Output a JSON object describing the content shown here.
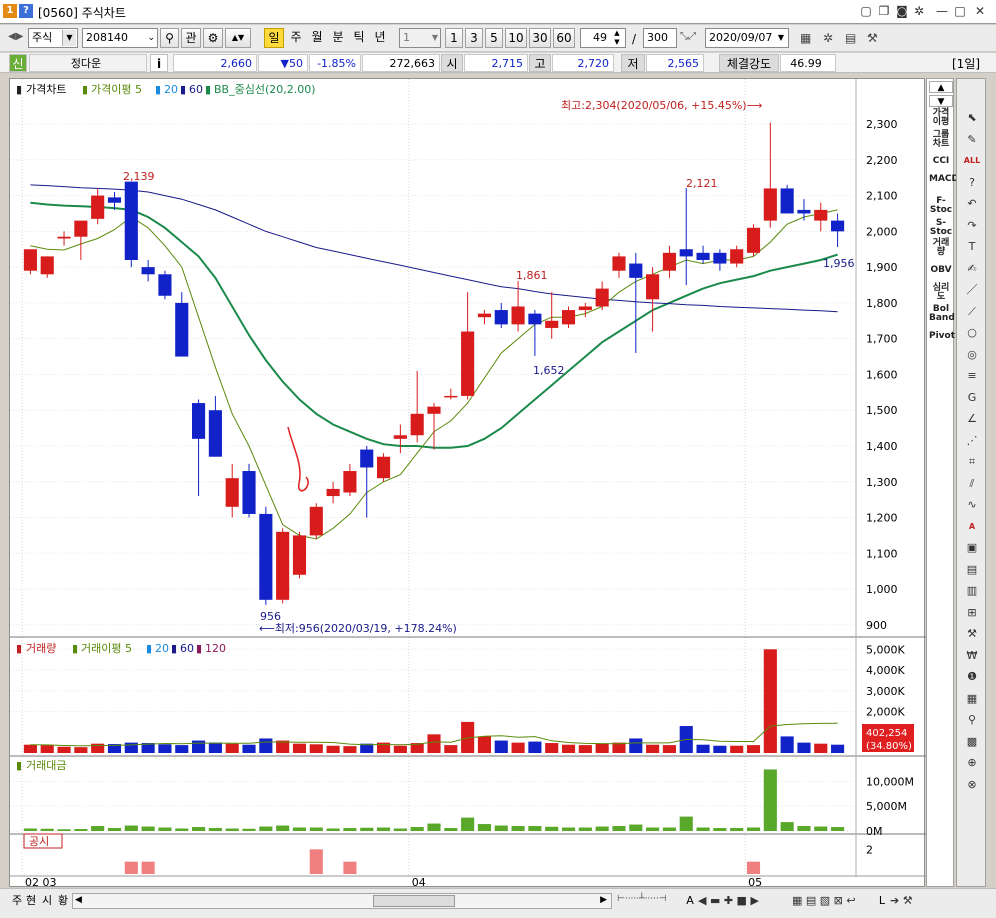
{
  "window": {
    "badge_num": "1",
    "badge_help": "?",
    "title": "[0560] 주식차트"
  },
  "toolbar": {
    "market": "주식",
    "code": "208140",
    "btn_watch": "관",
    "periods": [
      "일",
      "주",
      "월",
      "분",
      "틱",
      "년"
    ],
    "active_period": "일",
    "interval": "1",
    "quick_intervals": [
      "1",
      "3",
      "5",
      "10",
      "30",
      "60"
    ],
    "view_count": "49",
    "total_count": "300",
    "separator": "/",
    "date": "2020/09/07"
  },
  "quote": {
    "type_badge": "신",
    "name": "정다운",
    "info_btn": "i",
    "price": "2,660",
    "change": "▼50",
    "change_pct": "-1.85%",
    "volume": "272,663",
    "open_label": "시",
    "open": "2,715",
    "high_label": "고",
    "high": "2,720",
    "low_label": "저",
    "low": "2,565",
    "strength_label": "체결강도",
    "strength": "46.99",
    "period_tag": "[1일]"
  },
  "chart_data": {
    "type": "candlestick",
    "price_panel": {
      "legend": [
        "가격차트",
        "가격이평 5",
        "20",
        "60",
        "BB_중심선(20,2.00)"
      ],
      "y_ticks": [
        2300,
        2200,
        2100,
        2000,
        1900,
        1800,
        1700,
        1600,
        1500,
        1400,
        1300,
        1200,
        1100,
        1000,
        900
      ],
      "y_tick_labels": [
        "2,300",
        "2,200",
        "2,100",
        "2,000",
        "1,900",
        "1,800",
        "1,700",
        "1,600",
        "1,500",
        "1,400",
        "1,300",
        "1,200",
        "1,100",
        "1,000",
        "900"
      ],
      "ylim": [
        880,
        2370
      ],
      "candles": [
        {
          "o": 1890,
          "h": 1940,
          "l": 1880,
          "c": 1950
        },
        {
          "o": 1880,
          "h": 1930,
          "l": 1870,
          "c": 1930
        },
        {
          "o": 1980,
          "h": 2000,
          "l": 1960,
          "c": 1985
        },
        {
          "o": 1985,
          "h": 2010,
          "l": 1920,
          "c": 2030
        },
        {
          "o": 2035,
          "h": 2120,
          "l": 2020,
          "c": 2100
        },
        {
          "o": 2095,
          "h": 2110,
          "l": 2060,
          "c": 2080
        },
        {
          "o": 2139,
          "h": 2139,
          "l": 1900,
          "c": 1920
        },
        {
          "o": 1900,
          "h": 1920,
          "l": 1860,
          "c": 1880
        },
        {
          "o": 1880,
          "h": 1890,
          "l": 1810,
          "c": 1820
        },
        {
          "o": 1800,
          "h": 1830,
          "l": 1650,
          "c": 1650
        },
        {
          "o": 1520,
          "h": 1530,
          "l": 1260,
          "c": 1420
        },
        {
          "o": 1500,
          "h": 1540,
          "l": 1370,
          "c": 1370
        },
        {
          "o": 1230,
          "h": 1350,
          "l": 1200,
          "c": 1310
        },
        {
          "o": 1330,
          "h": 1350,
          "l": 1200,
          "c": 1210
        },
        {
          "o": 1210,
          "h": 1230,
          "l": 956,
          "c": 970
        },
        {
          "o": 970,
          "h": 1170,
          "l": 960,
          "c": 1160
        },
        {
          "o": 1040,
          "h": 1160,
          "l": 1030,
          "c": 1150
        },
        {
          "o": 1150,
          "h": 1240,
          "l": 1140,
          "c": 1230
        },
        {
          "o": 1260,
          "h": 1300,
          "l": 1240,
          "c": 1280
        },
        {
          "o": 1270,
          "h": 1350,
          "l": 1260,
          "c": 1330
        },
        {
          "o": 1390,
          "h": 1400,
          "l": 1200,
          "c": 1340
        },
        {
          "o": 1310,
          "h": 1380,
          "l": 1300,
          "c": 1370
        },
        {
          "o": 1420,
          "h": 1460,
          "l": 1380,
          "c": 1430
        },
        {
          "o": 1430,
          "h": 1610,
          "l": 1410,
          "c": 1490
        },
        {
          "o": 1490,
          "h": 1520,
          "l": 1390,
          "c": 1510
        },
        {
          "o": 1540,
          "h": 1560,
          "l": 1530,
          "c": 1540
        },
        {
          "o": 1540,
          "h": 1830,
          "l": 1530,
          "c": 1720
        },
        {
          "o": 1760,
          "h": 1780,
          "l": 1740,
          "c": 1770
        },
        {
          "o": 1780,
          "h": 1800,
          "l": 1730,
          "c": 1740
        },
        {
          "o": 1740,
          "h": 1861,
          "l": 1720,
          "c": 1790
        },
        {
          "o": 1770,
          "h": 1780,
          "l": 1652,
          "c": 1740
        },
        {
          "o": 1730,
          "h": 1830,
          "l": 1700,
          "c": 1750
        },
        {
          "o": 1740,
          "h": 1790,
          "l": 1730,
          "c": 1780
        },
        {
          "o": 1780,
          "h": 1800,
          "l": 1760,
          "c": 1790
        },
        {
          "o": 1790,
          "h": 1860,
          "l": 1780,
          "c": 1840
        },
        {
          "o": 1890,
          "h": 1940,
          "l": 1870,
          "c": 1930
        },
        {
          "o": 1910,
          "h": 1940,
          "l": 1660,
          "c": 1870
        },
        {
          "o": 1810,
          "h": 1900,
          "l": 1720,
          "c": 1880
        },
        {
          "o": 1890,
          "h": 1960,
          "l": 1870,
          "c": 1940
        },
        {
          "o": 1950,
          "h": 2121,
          "l": 1850,
          "c": 1930
        },
        {
          "o": 1940,
          "h": 1960,
          "l": 1910,
          "c": 1920
        },
        {
          "o": 1940,
          "h": 1950,
          "l": 1890,
          "c": 1910
        },
        {
          "o": 1910,
          "h": 1960,
          "l": 1900,
          "c": 1950
        },
        {
          "o": 1940,
          "h": 2020,
          "l": 1930,
          "c": 2010
        },
        {
          "o": 2030,
          "h": 2304,
          "l": 2010,
          "c": 2120
        },
        {
          "o": 2120,
          "h": 2130,
          "l": 2050,
          "c": 2050
        },
        {
          "o": 2060,
          "h": 2090,
          "l": 2030,
          "c": 2050
        },
        {
          "o": 2030,
          "h": 2080,
          "l": 2000,
          "c": 2060
        },
        {
          "o": 2030,
          "h": 2050,
          "l": 1956,
          "c": 2000
        }
      ],
      "ma5": [
        1960,
        1950,
        1948,
        1965,
        1980,
        2005,
        2040,
        2010,
        1960,
        1900,
        1760,
        1620,
        1490,
        1400,
        1290,
        1180,
        1150,
        1140,
        1170,
        1210,
        1270,
        1300,
        1320,
        1380,
        1440,
        1470,
        1520,
        1590,
        1660,
        1700,
        1740,
        1760,
        1760,
        1770,
        1790,
        1830,
        1860,
        1880,
        1900,
        1920,
        1910,
        1920,
        1920,
        1930,
        1970,
        2020,
        2040,
        2050,
        2060
      ],
      "ma60": [
        2130,
        2128,
        2125,
        2122,
        2120,
        2118,
        2115,
        2110,
        2100,
        2090,
        2075,
        2060,
        2040,
        2020,
        2000,
        1985,
        1970,
        1955,
        1945,
        1935,
        1925,
        1915,
        1905,
        1895,
        1885,
        1875,
        1865,
        1855,
        1845,
        1840,
        1832,
        1825,
        1820,
        1815,
        1810,
        1807,
        1803,
        1800,
        1798,
        1795,
        1793,
        1790,
        1788,
        1786,
        1784,
        1782,
        1780,
        1778,
        1775
      ],
      "bb_mid": [
        2080,
        2075,
        2072,
        2070,
        2068,
        2065,
        2060,
        2040,
        2010,
        1970,
        1930,
        1870,
        1790,
        1710,
        1640,
        1580,
        1530,
        1490,
        1460,
        1440,
        1420,
        1405,
        1400,
        1400,
        1395,
        1395,
        1400,
        1420,
        1450,
        1490,
        1530,
        1570,
        1610,
        1650,
        1690,
        1720,
        1750,
        1780,
        1800,
        1820,
        1840,
        1855,
        1865,
        1875,
        1890,
        1900,
        1910,
        1920,
        1935
      ],
      "annotations": {
        "max_label": "최고:2,304(2020/05/06, +15.45%)⟶",
        "min_label": "⟵최저:956(2020/03/19, +178.24%)",
        "peak1": "2,139",
        "peak2": "2,121",
        "peak3": "1,861",
        "trough1": "956",
        "trough2": "1,652",
        "last": "1,956"
      }
    },
    "volume_panel": {
      "legend": [
        "거래량",
        "거래이평 5",
        "20",
        "60",
        "120"
      ],
      "y_tick_labels": [
        "5,000K",
        "4,000K",
        "3,000K",
        "2,000K"
      ],
      "y_ticks": [
        5000,
        4000,
        3000,
        2000
      ],
      "ylim": [
        0,
        5400
      ],
      "values": [
        400,
        380,
        300,
        280,
        450,
        430,
        500,
        480,
        420,
        380,
        600,
        500,
        450,
        400,
        700,
        600,
        450,
        420,
        350,
        330,
        450,
        500,
        350,
        480,
        900,
        380,
        1500,
        800,
        600,
        500,
        550,
        480,
        400,
        380,
        450,
        500,
        700,
        400,
        380,
        1300,
        400,
        350,
        350,
        380,
        5000,
        800,
        500,
        450,
        400
      ],
      "current_value": "402,254",
      "current_pct": "(34.80%)"
    },
    "amount_panel": {
      "legend": [
        "거래대금"
      ],
      "y_tick_labels": [
        "10,000M",
        "5,000M",
        "0M"
      ],
      "y_ticks": [
        10000,
        5000,
        0
      ],
      "ylim": [
        0,
        14500
      ],
      "values": [
        500,
        450,
        350,
        400,
        1000,
        600,
        1100,
        900,
        700,
        500,
        800,
        600,
        500,
        450,
        900,
        1100,
        700,
        700,
        500,
        600,
        650,
        700,
        500,
        800,
        1500,
        600,
        2700,
        1400,
        1100,
        1000,
        1000,
        850,
        700,
        700,
        900,
        1000,
        1300,
        700,
        700,
        2900,
        700,
        600,
        600,
        700,
        12400,
        1800,
        1000,
        900,
        800
      ]
    },
    "notice_panel": {
      "legend": "공시",
      "y_tick_labels": [
        "2"
      ],
      "y_ticks": [
        2
      ],
      "ylim": [
        0,
        3
      ],
      "values": [
        0,
        0,
        0,
        0,
        0,
        0,
        1,
        1,
        0,
        0,
        0,
        0,
        0,
        0,
        0,
        0,
        0,
        2,
        0,
        1,
        0,
        0,
        0,
        0,
        0,
        0,
        0,
        0,
        0,
        0,
        0,
        0,
        0,
        0,
        0,
        0,
        0,
        0,
        0,
        0,
        0,
        0,
        0,
        1,
        0,
        0,
        0,
        0,
        0
      ]
    },
    "x_labels": [
      {
        "index": 0,
        "label": "02 03"
      },
      {
        "index": 23,
        "label": "04"
      },
      {
        "index": 43,
        "label": "05"
      }
    ],
    "colors": {
      "up": "#d81c1c",
      "down": "#1022c8",
      "ma5": "#5a8a0a",
      "ma60": "#1a1a8a",
      "bb": "#1a8a4a"
    }
  },
  "right_indicators": [
    "가격이평",
    "그룹차트",
    "CCI",
    "MACD",
    "F-Stoc",
    "S-Stoc",
    "거래량",
    "OBV",
    "심리도",
    "Bol Band",
    "Pivot"
  ],
  "tools": [
    "cursor-icon",
    "eraser-icon",
    "all-icon",
    "help-icon",
    "undo-icon",
    "redo-icon",
    "text-icon",
    "marker-icon",
    "line-icon",
    "trend-icon",
    "circle-icon",
    "cycle-icon",
    "fibo-icon",
    "gann-icon",
    "angle-icon",
    "fan-icon",
    "grid-icon",
    "channel-icon",
    "wave-icon",
    "auto-icon",
    "screen-icon",
    "note-icon",
    "chart-icon",
    "compare-icon",
    "tool-icon",
    "price-icon",
    "alert-icon",
    "news-icon",
    "search-icon",
    "excel-icon",
    "zoom-icon",
    "target-icon"
  ],
  "bottom": {
    "tabs": [
      "주",
      "현",
      "시",
      "황"
    ],
    "right_labels": [
      "A",
      "L"
    ]
  }
}
